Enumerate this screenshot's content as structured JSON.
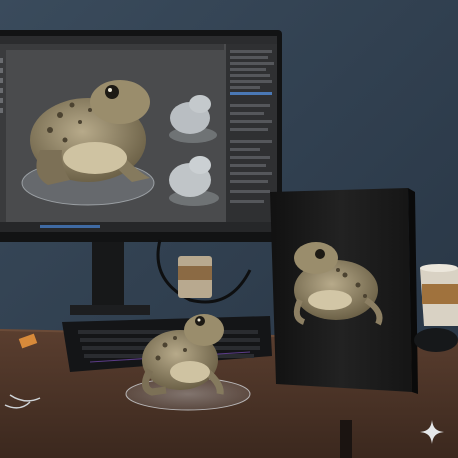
{
  "scene": {
    "description_icon": "toad-figurine-desk-scene",
    "colors": {
      "wall": "#2f3e4e",
      "desk": "#4a3226",
      "monitor_bezel": "#141414",
      "viewport_bg": "#4b4c4e",
      "box": "#1b1b1c",
      "toad_body": "#8c7f63",
      "toad_spots": "#4c4331",
      "cup": "#d9d2c4",
      "cup_sleeve": "#a0723d"
    }
  },
  "watermark": {
    "icon": "sparkle-icon"
  }
}
